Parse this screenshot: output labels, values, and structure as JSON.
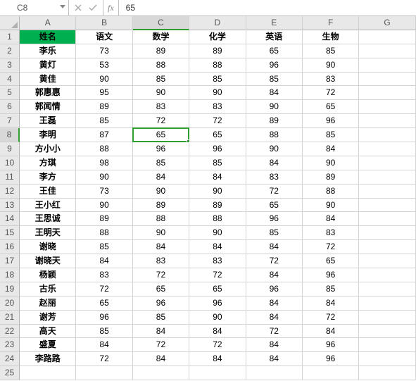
{
  "formula_bar": {
    "cell_ref": "C8",
    "fx_label": "fx",
    "value": "65"
  },
  "columns": [
    "A",
    "B",
    "C",
    "D",
    "E",
    "F",
    "G"
  ],
  "row_count": 25,
  "active": {
    "col": "C",
    "row": 8
  },
  "headers": [
    "姓名",
    "语文",
    "数学",
    "化学",
    "英语",
    "生物"
  ],
  "rows": [
    {
      "name": "李乐",
      "scores": [
        73,
        89,
        89,
        65,
        85
      ]
    },
    {
      "name": "黄灯",
      "scores": [
        53,
        88,
        88,
        96,
        90
      ]
    },
    {
      "name": "黄佳",
      "scores": [
        90,
        85,
        85,
        85,
        83
      ]
    },
    {
      "name": "郭惠惠",
      "scores": [
        95,
        90,
        90,
        84,
        72
      ]
    },
    {
      "name": "郭闻情",
      "scores": [
        89,
        83,
        83,
        90,
        65
      ]
    },
    {
      "name": "王磊",
      "scores": [
        85,
        72,
        72,
        89,
        96
      ]
    },
    {
      "name": "李明",
      "scores": [
        87,
        65,
        65,
        88,
        85
      ]
    },
    {
      "name": "方小小",
      "scores": [
        88,
        96,
        96,
        90,
        84
      ]
    },
    {
      "name": "方琪",
      "scores": [
        98,
        85,
        85,
        84,
        90
      ]
    },
    {
      "name": "李方",
      "scores": [
        90,
        84,
        84,
        83,
        89
      ]
    },
    {
      "name": "王佳",
      "scores": [
        73,
        90,
        90,
        72,
        88
      ]
    },
    {
      "name": "王小红",
      "scores": [
        90,
        89,
        89,
        65,
        90
      ]
    },
    {
      "name": "王思诚",
      "scores": [
        89,
        88,
        88,
        96,
        84
      ]
    },
    {
      "name": "王明天",
      "scores": [
        88,
        90,
        90,
        85,
        83
      ]
    },
    {
      "name": "谢晓",
      "scores": [
        85,
        84,
        84,
        84,
        72
      ]
    },
    {
      "name": "谢晓天",
      "scores": [
        84,
        83,
        83,
        72,
        65
      ]
    },
    {
      "name": "杨颖",
      "scores": [
        83,
        72,
        72,
        84,
        96
      ]
    },
    {
      "name": "古乐",
      "scores": [
        72,
        65,
        65,
        96,
        85
      ]
    },
    {
      "name": "赵丽",
      "scores": [
        65,
        96,
        96,
        84,
        84
      ]
    },
    {
      "name": "谢芳",
      "scores": [
        96,
        85,
        90,
        84,
        72
      ]
    },
    {
      "name": "高天",
      "scores": [
        85,
        84,
        84,
        72,
        84
      ]
    },
    {
      "name": "盛夏",
      "scores": [
        84,
        72,
        72,
        84,
        96
      ]
    },
    {
      "name": "李路路",
      "scores": [
        72,
        84,
        84,
        84,
        96
      ]
    }
  ]
}
